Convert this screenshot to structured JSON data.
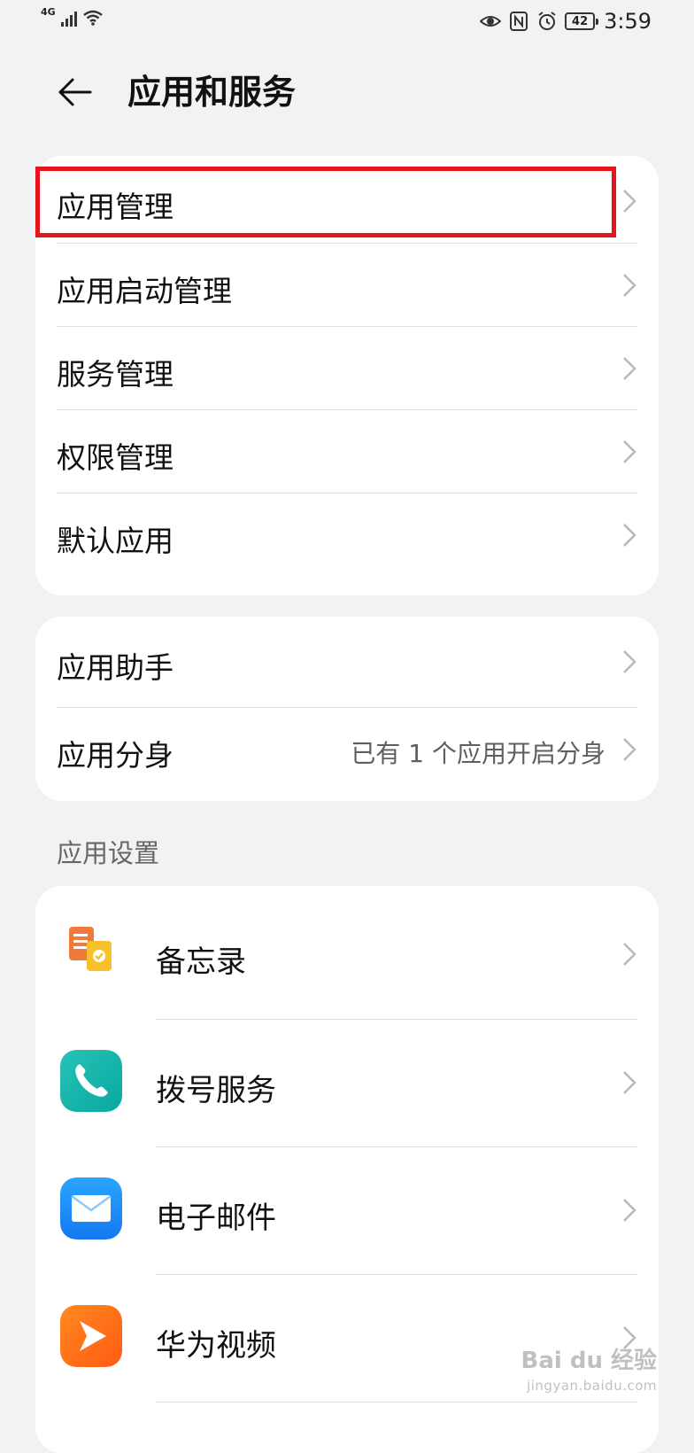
{
  "status_bar": {
    "network": "4G",
    "battery": "42",
    "time": "3:59"
  },
  "header": {
    "title": "应用和服务"
  },
  "group1": [
    {
      "label": "应用管理"
    },
    {
      "label": "应用启动管理"
    },
    {
      "label": "服务管理"
    },
    {
      "label": "权限管理"
    },
    {
      "label": "默认应用"
    }
  ],
  "group2": [
    {
      "label": "应用助手",
      "value": ""
    },
    {
      "label": "应用分身",
      "value": "已有 1 个应用开启分身"
    }
  ],
  "section_app_settings": "应用设置",
  "apps": [
    {
      "label": "备忘录",
      "icon": "notepad-icon"
    },
    {
      "label": "拨号服务",
      "icon": "phone-icon"
    },
    {
      "label": "电子邮件",
      "icon": "email-icon"
    },
    {
      "label": "华为视频",
      "icon": "video-icon"
    }
  ],
  "watermark": {
    "brand": "Bai du 经验",
    "url": "jingyan.baidu.com"
  },
  "colors": {
    "highlight": "#e8141c",
    "background": "#f1f2f4"
  }
}
